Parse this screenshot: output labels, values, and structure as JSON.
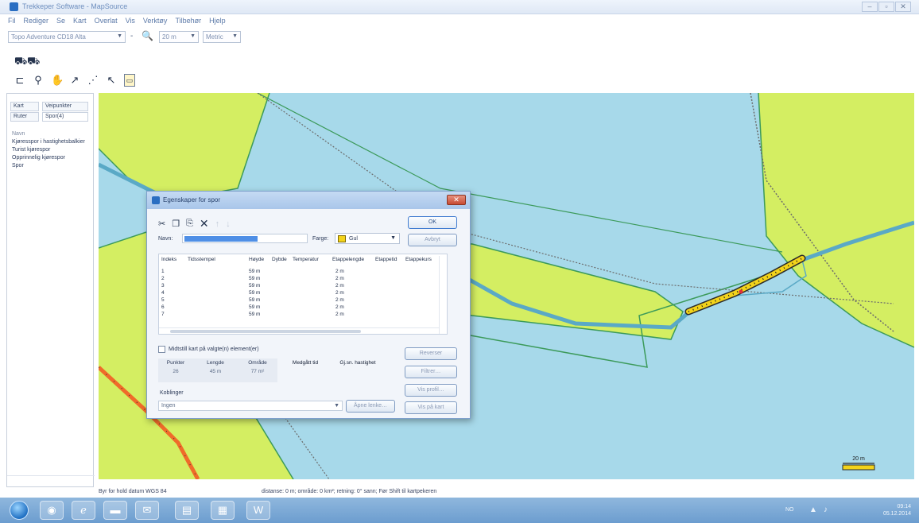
{
  "window": {
    "title": "Trekkeper Software - MapSource",
    "controls": [
      "–",
      "▫",
      "✕"
    ]
  },
  "menu": [
    "Fil",
    "Rediger",
    "Se",
    "Kart",
    "Overlat",
    "Vis",
    "Verktøy",
    "Tilbehør",
    "Hjelp"
  ],
  "toolbar": {
    "map_product": "Topo Adventure CD18 Alta",
    "zoom_level": "20 m",
    "units": "Metric"
  },
  "left_panel": {
    "tabs": [
      "Kart",
      "Veipunkter",
      "Ruter",
      "Spor(4)"
    ],
    "list_header": "Navn",
    "items": [
      "Kjøresspor i hastighetsbalkier",
      "Turist kjørespor",
      "Opprinnelig kjørespor",
      "Spor"
    ]
  },
  "dialog": {
    "title": "Egenskaper for spor",
    "close_label": "✕",
    "buttons": {
      "ok": "OK",
      "cancel": "Avbryt",
      "reverse": "Reverser",
      "filter": "Filtrer…",
      "show_profile": "Vis profil…",
      "show_on_map": "Vis på kart",
      "show_on_map_inline": "Vis på kart",
      "open_link": "Åpne lenke…"
    },
    "name_label": "Navn:",
    "color_label": "Farge:",
    "color_value": "Gul",
    "columns": [
      "Indeks",
      "Tidsstempel",
      "Høyde",
      "Dybde",
      "Temperatur",
      "Etappelengde",
      "Etappetid",
      "Etappekurs"
    ],
    "rows": [
      {
        "index": "1",
        "height": "59 m",
        "leg": "2 m"
      },
      {
        "index": "2",
        "height": "59 m",
        "leg": "2 m"
      },
      {
        "index": "3",
        "height": "59 m",
        "leg": "2 m"
      },
      {
        "index": "4",
        "height": "59 m",
        "leg": "2 m"
      },
      {
        "index": "5",
        "height": "59 m",
        "leg": "2 m"
      },
      {
        "index": "6",
        "height": "59 m",
        "leg": "2 m"
      },
      {
        "index": "7",
        "height": "59 m",
        "leg": "2 m"
      }
    ],
    "checkbox_label": "Midtstill kart på valgte(n) element(er)",
    "stats": {
      "points_label": "Punkter",
      "points_value": "26",
      "length_label": "Lengde",
      "length_value": "45 m",
      "area_label": "Område",
      "area_value": "77 m²",
      "time_label": "Medgått tid",
      "speed_label": "Gj.sn. hastighet"
    },
    "links_label": "Koblinger",
    "links_value": "Ingen"
  },
  "status": {
    "left": "Byr for hold datum WGS 84",
    "middle": "distanse: 0 m; område: 0 km²; retning: 0° sann; Før Shift til kartpekeren"
  },
  "map": {
    "scale_label": "20 m"
  },
  "taskbar": {
    "apps": [
      "chrome-icon",
      "ie-icon",
      "explorer-icon",
      "mail-icon",
      "notes-icon",
      "mapsource-icon",
      "word-icon"
    ],
    "tray_text": "NO",
    "time": "09:14",
    "date": "05.12.2014"
  },
  "colors": {
    "water": "#a7d9ea",
    "land": "#d4ee62",
    "boundary": "#3c9a5a",
    "track": "#5aa9c6",
    "active_track": "#f3d31a",
    "road": "#ef6b2a"
  }
}
